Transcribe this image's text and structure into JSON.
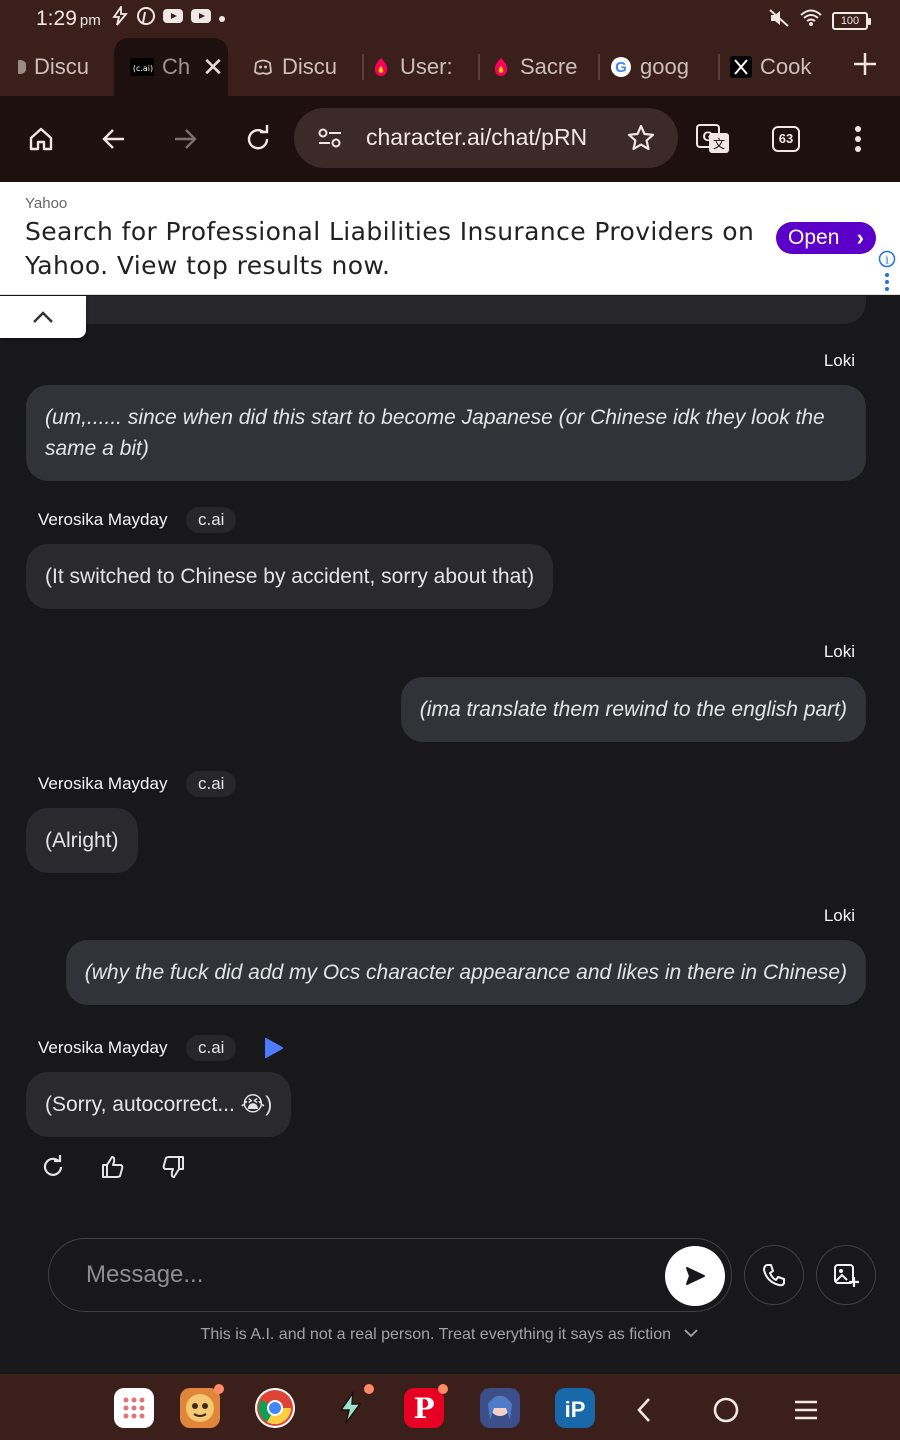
{
  "status_bar": {
    "time": "1:29",
    "ampm": "pm",
    "battery": "100"
  },
  "tabs": [
    {
      "label": "Discu",
      "icon": "discord-icon"
    },
    {
      "label": "Ch",
      "icon": "cai-icon",
      "active": true,
      "favicon_text": "c.ai"
    },
    {
      "label": "Discu",
      "icon": "discord-icon"
    },
    {
      "label": "User:",
      "icon": "fandom-icon"
    },
    {
      "label": "Sacre",
      "icon": "fandom-icon"
    },
    {
      "label": "goog",
      "icon": "google-icon"
    },
    {
      "label": "Cook",
      "icon": "x-icon"
    }
  ],
  "toolbar": {
    "url": "character.ai/chat/pRN",
    "tab_count": "63"
  },
  "ad": {
    "source": "Yahoo",
    "headline": "Search for Professional Liabilities Insurance Providers on Yahoo. View top results now.",
    "open_label": "Open"
  },
  "chat": {
    "messages": [
      {
        "author": "Loki",
        "role": "user",
        "text": "(um,...... since when did this start to become Japanese (or Chinese idk they look the same a bit)"
      },
      {
        "author": "Verosika Mayday",
        "badge": "c.ai",
        "role": "bot",
        "text": "(It switched to Chinese by accident, sorry about that)"
      },
      {
        "author": "Loki",
        "role": "user",
        "text": "(ima translate them rewind to the english part)"
      },
      {
        "author": "Verosika Mayday",
        "badge": "c.ai",
        "role": "bot",
        "text": "(Alright)"
      },
      {
        "author": "Loki",
        "role": "user",
        "text": "(why the fuck did add my Ocs character appearance and likes in there in Chinese)"
      },
      {
        "author": "Verosika Mayday",
        "badge": "c.ai",
        "role": "bot",
        "text": "(Sorry, autocorrect... 😭)"
      }
    ]
  },
  "composer": {
    "placeholder": "Message...",
    "disclaimer": "This is A.I. and not a real person. Treat everything it says as fiction"
  },
  "colors": {
    "chrome_bg": "#3a1f1b",
    "toolbar_bg": "#1e100e",
    "chat_bg": "#18181b",
    "ad_button": "#5a00c8",
    "play_icon": "#4f7cff"
  }
}
